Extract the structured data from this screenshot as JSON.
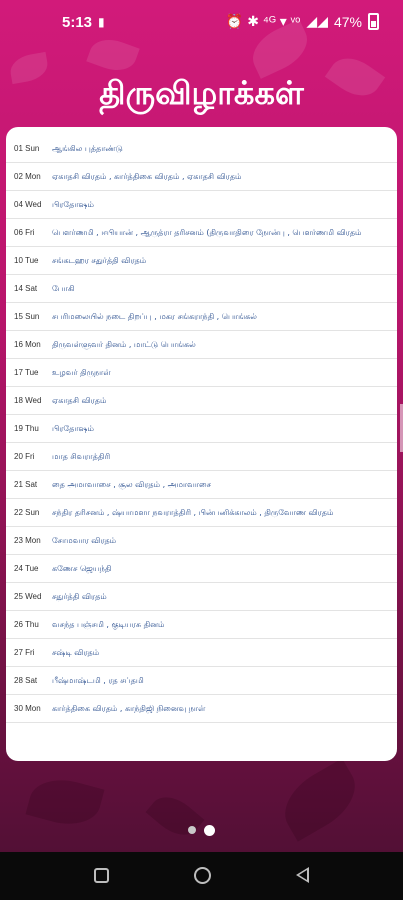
{
  "status": {
    "time": "5:13",
    "left_icon": "sim-card-icon",
    "icons": "⏰ ✱ ⁴ᴳ ▾ ᵛᵒ",
    "battery": "47%"
  },
  "title": "திருவிழாக்கள்",
  "events": [
    {
      "date": "01 Sun",
      "text": "ஆங்கில புத்தாண்டு"
    },
    {
      "date": "02 Mon",
      "text": "ஏகாதசி விரதம் , கார்த்திகை விரதம் , ஏகாதசி விரதம்"
    },
    {
      "date": "04 Wed",
      "text": "பிரதோஷம்"
    },
    {
      "date": "06 Fri",
      "text": "பௌர்ணமி , ஈபியான் , ஆருத்ரா தரிசனம் (திருவாதிரை நோன்பு , பௌர்ணமி விரதம்"
    },
    {
      "date": "10 Tue",
      "text": "சங்கடஹர சதுர்த்தி விரதம்"
    },
    {
      "date": "14 Sat",
      "text": "போகி"
    },
    {
      "date": "15 Sun",
      "text": "சபரிமலையில் நடை திறப்பு , மகர சங்கராந்தி , பொங்கல்"
    },
    {
      "date": "16 Mon",
      "text": "திருவள்ளுவர் தினம் , மாட்டு பொங்கல்"
    },
    {
      "date": "17 Tue",
      "text": "உழவர் திருநாள்"
    },
    {
      "date": "18 Wed",
      "text": "ஏகாதசி விரதம்"
    },
    {
      "date": "19 Thu",
      "text": "பிரதோஷம்"
    },
    {
      "date": "20 Fri",
      "text": "மாத சிவராத்திரி"
    },
    {
      "date": "21 Sat",
      "text": "தை அமாவாசை , சூல விரதம் , அமாவாசை"
    },
    {
      "date": "22 Sun",
      "text": "சந்திர தரிசனம் , ஷ்யாமளா நவராத்திரி , பின்பனிக்காலம் , திருவோண விரதம்"
    },
    {
      "date": "23 Mon",
      "text": "சோமவார விரதம்"
    },
    {
      "date": "24 Tue",
      "text": "கணேச ஜெயந்தி"
    },
    {
      "date": "25 Wed",
      "text": "சதுர்த்தி விரதம்"
    },
    {
      "date": "26 Thu",
      "text": "வசந்த பஞ்சமி , குடியரசு தினம்"
    },
    {
      "date": "27 Fri",
      "text": "சஷ்டி விரதம்"
    },
    {
      "date": "28 Sat",
      "text": "பீஷ்மாஷ்டமி , ரத சப்தமி"
    },
    {
      "date": "30 Mon",
      "text": "கார்த்திகை விரதம் , காந்திஜி நினைவு நாள்"
    }
  ],
  "pager": {
    "count": 2,
    "active": 2
  },
  "colors": {
    "accent": "#d21a7a",
    "event_text": "#2a4f8f",
    "date_text": "#333333"
  }
}
